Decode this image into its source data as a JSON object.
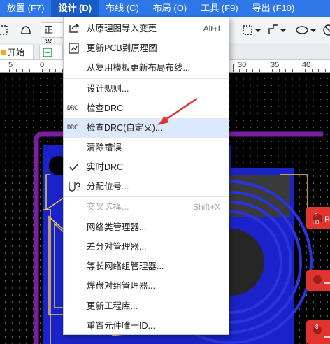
{
  "menubar": {
    "items": [
      "放置 (F7)",
      "设计 (D)",
      "布线 (C)",
      "布局 (O)",
      "工具 (F9)",
      "导出 (F10)"
    ]
  },
  "toolbar": {
    "dropdown_text": "正常"
  },
  "tabs": {
    "home_label": "开始页"
  },
  "ruler": {
    "labels": [
      "5",
      "0",
      "30",
      "35",
      "40"
    ]
  },
  "menu": {
    "items": [
      {
        "label": "从原理图导入变更",
        "shortcut": "Alt+I",
        "icon": "import-icon"
      },
      {
        "label": "更新PCB到原理图",
        "icon": "update-schematic-icon"
      },
      {
        "label": "从复用模板更新布局布线...",
        "icon": ""
      },
      {
        "label": "设计规则...",
        "icon": ""
      },
      {
        "label": "检查DRC",
        "icon": "drc-icon",
        "icon_text": "DRC"
      },
      {
        "label": "检查DRC(自定义)...",
        "icon": "drc-custom-icon",
        "icon_text": "DRC"
      },
      {
        "label": "清除错误",
        "icon": ""
      },
      {
        "label": "实时DRC",
        "icon": "checkmark-icon"
      },
      {
        "label": "分配位号...",
        "icon": "assign-designator-icon"
      },
      {
        "label": "交叉选择...",
        "shortcut": "Shift+X",
        "icon": "",
        "disabled": true
      },
      {
        "label": "网络类管理器...",
        "icon": ""
      },
      {
        "label": "差分对管理器...",
        "icon": ""
      },
      {
        "label": "等长网络组管理器...",
        "icon": ""
      },
      {
        "label": "焊盘对组管理器...",
        "icon": ""
      },
      {
        "label": "更新工程库...",
        "icon": ""
      },
      {
        "label": "重置元件唯一ID...",
        "icon": ""
      }
    ]
  },
  "canvas": {
    "pad_labels": [
      "3",
      "HB",
      "B",
      "8",
      "+"
    ]
  },
  "colors": {
    "menubar": "#2e77e8",
    "board_outline": "#7b1fa2",
    "copper_top": "#f2c94c",
    "copper_bottom": "#1a23c9",
    "pad": "#e0342f",
    "annotation_arrow": "#e03131",
    "hover": "#dbe9fb"
  }
}
